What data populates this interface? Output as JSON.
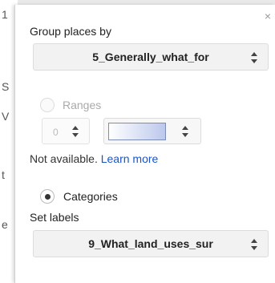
{
  "background_edge": {
    "chars": [
      "1",
      "S",
      "V",
      "t",
      "e"
    ]
  },
  "panel": {
    "close_glyph": "×",
    "group_places_label": "Group places by",
    "group_select_value": "5_Generally_what_for",
    "ranges_label": "Ranges",
    "ranges_number_value": "0",
    "not_available_text": "Not available.",
    "learn_more_link": "Learn more",
    "categories_label": "Categories",
    "set_labels_label": "Set labels",
    "labels_select_value": "9_What_land_uses_sur",
    "selected_mode": "Categories"
  },
  "colors": {
    "link": "#1a55c7",
    "swatch_start": "#ffffff",
    "swatch_end": "#bcc8ec",
    "swatch_border": "#7d8db8"
  },
  "icons": {
    "close": "close-icon",
    "select_caret": "up-down-caret-icon"
  }
}
